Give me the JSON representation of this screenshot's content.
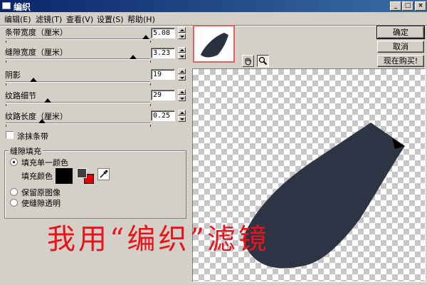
{
  "window": {
    "title": "编织"
  },
  "titlebar_buttons": {
    "minimize": "_",
    "maximize": "□",
    "close": "×"
  },
  "menu": [
    "编辑(E)",
    "滤镜(T)",
    "查看(V)",
    "设置(S)",
    "帮助(H)"
  ],
  "sliders": [
    {
      "label": "条带宽度（厘米）",
      "value": "5.08",
      "level": 0.97
    },
    {
      "label": "缝隙宽度（厘米）",
      "value": "3.23",
      "level": 0.88
    },
    {
      "label": "阴影",
      "value": "19",
      "level": 0.19
    },
    {
      "label": "纹路细节",
      "value": "29",
      "level": 0.29
    },
    {
      "label": "纹路长度（厘米）",
      "value": "0.25",
      "level": 0.25
    }
  ],
  "smear_strips": {
    "label": "涂抹条带",
    "checked": false
  },
  "gap_fill": {
    "title": "缝隙填充",
    "options": [
      {
        "label": "填充单一颜色",
        "selected": true
      },
      {
        "label": "保留原图像",
        "selected": false
      },
      {
        "label": "使缝隙透明",
        "selected": false
      }
    ],
    "fill_color_label": "填充颜色",
    "fill_color": "#000000",
    "secondary_colors": [
      "#404040",
      "#e00000"
    ]
  },
  "buttons": {
    "ok": "确定",
    "cancel": "取消",
    "buy": "现在购买!"
  },
  "tools": {
    "hand": "hand-icon",
    "zoom": "zoom-icon"
  },
  "preview_colors": {
    "fabric": "#2a3140",
    "checker": "#c6c6c6"
  },
  "overlay_text": "我用“编织”滤镜"
}
